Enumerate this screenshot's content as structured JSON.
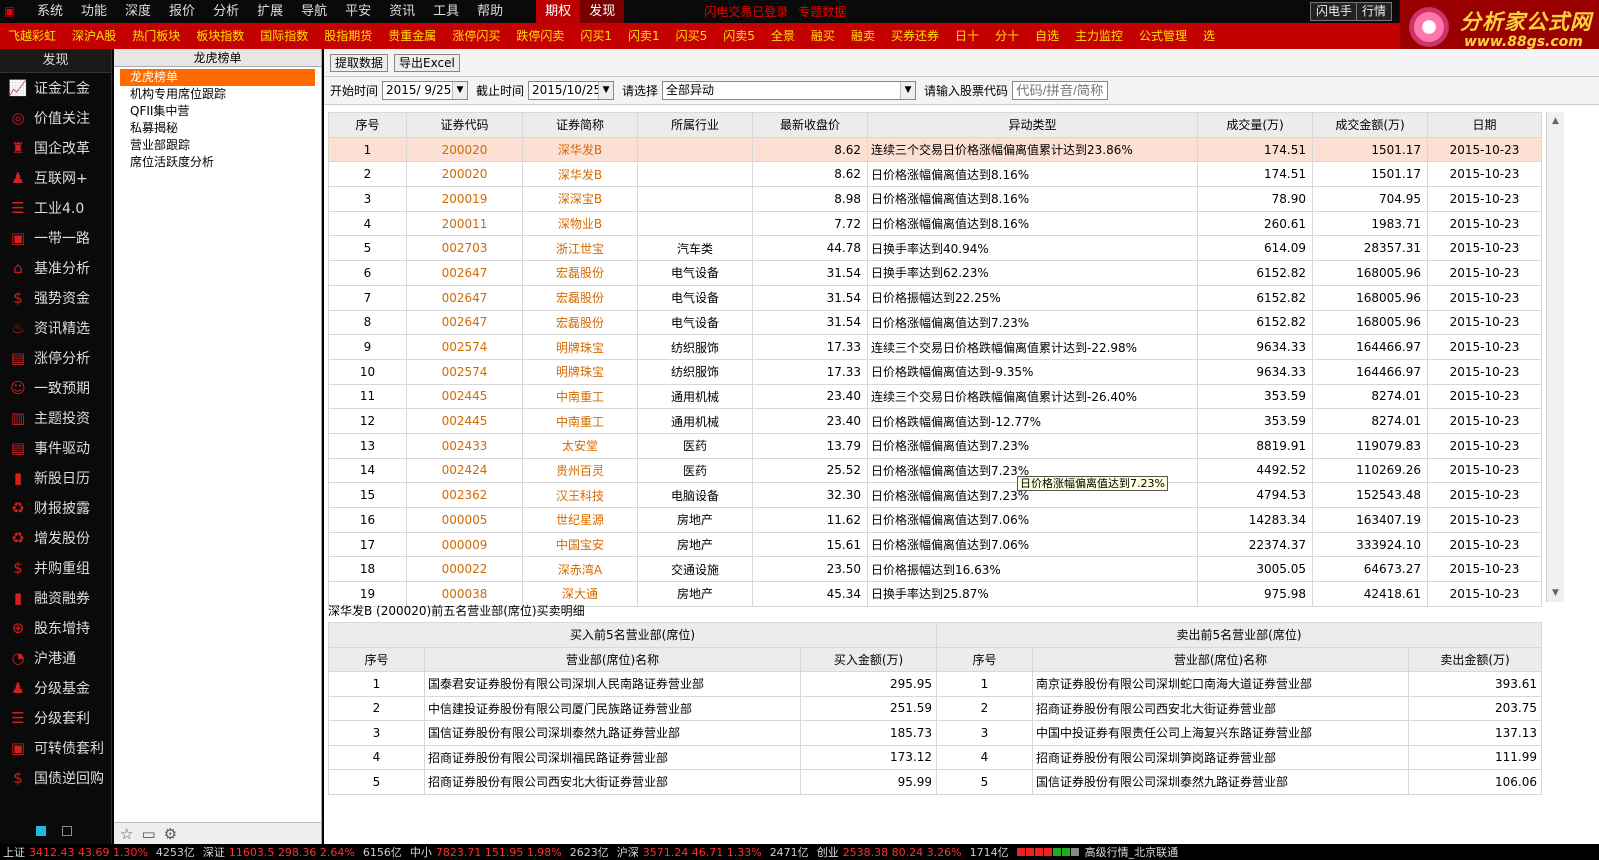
{
  "menubar": {
    "items": [
      "系统",
      "功能",
      "深度",
      "报价",
      "分析",
      "扩展",
      "导航",
      "平安",
      "资讯",
      "工具",
      "帮助"
    ],
    "tab_option": "期权",
    "tab_discover": "发现",
    "notice": "闪电交易已登录",
    "notice2": "专题数据",
    "right_btn1": "闪电手",
    "right_btn2": "行情"
  },
  "brand": {
    "title": "分析家公式网",
    "url": "www.88gs.com"
  },
  "toolbar": {
    "items": [
      "飞越彩虹",
      "深沪A股",
      "热门板块",
      "板块指数",
      "国际指数",
      "股指期货",
      "贵重金属",
      "涨停闪买",
      "跌停闪卖",
      "闪买1",
      "闪卖1",
      "闪买5",
      "闪卖5",
      "全景",
      "融买",
      "融卖",
      "买券还券",
      "日十",
      "分十",
      "自选",
      "主力监控",
      "公式管理",
      "选"
    ]
  },
  "sidebar": {
    "header": "发现",
    "items": [
      {
        "label": "证金汇金",
        "icon": "chart-line-icon"
      },
      {
        "label": "价值关注",
        "icon": "target-icon"
      },
      {
        "label": "国企改革",
        "icon": "building-icon"
      },
      {
        "label": "互联网+",
        "icon": "person-icon"
      },
      {
        "label": "工业4.0",
        "icon": "coins-icon"
      },
      {
        "label": "一带一路",
        "icon": "monitor-icon"
      },
      {
        "label": "基准分析",
        "icon": "bank-icon"
      },
      {
        "label": "强势资金",
        "icon": "money-icon"
      },
      {
        "label": "资讯精选",
        "icon": "piggy-icon"
      },
      {
        "label": "涨停分析",
        "icon": "window-icon"
      },
      {
        "label": "一致预期",
        "icon": "user-icon"
      },
      {
        "label": "主题投资",
        "icon": "briefcase-icon"
      },
      {
        "label": "事件驱动",
        "icon": "window-icon"
      },
      {
        "label": "新股日历",
        "icon": "bars-icon"
      },
      {
        "label": "财报披露",
        "icon": "cycle-icon"
      },
      {
        "label": "增发股份",
        "icon": "cycle-icon"
      },
      {
        "label": "并购重组",
        "icon": "money-icon"
      },
      {
        "label": "融资融券",
        "icon": "bars-icon"
      },
      {
        "label": "股东增持",
        "icon": "globe-icon"
      },
      {
        "label": "沪港通",
        "icon": "clock-icon"
      },
      {
        "label": "分级基金",
        "icon": "person-icon"
      },
      {
        "label": "分级套利",
        "icon": "coins-icon"
      },
      {
        "label": "可转债套利",
        "icon": "monitor-icon"
      },
      {
        "label": "国债逆回购",
        "icon": "money-icon"
      }
    ]
  },
  "tree": {
    "header": "龙虎榜单",
    "items": [
      "龙虎榜单",
      "机构专用席位跟踪",
      "QFII集中营",
      "私募揭秘",
      "营业部跟踪",
      "席位活跃度分析"
    ]
  },
  "actions": {
    "fetch": "提取数据",
    "export": "导出Excel"
  },
  "filter": {
    "start_label": "开始时间",
    "start_value": "2015/ 9/25",
    "end_label": "截止时间",
    "end_value": "2015/10/25",
    "select_label": "请选择",
    "select_value": "全部异动",
    "code_label": "请输入股票代码",
    "code_placeholder": "代码/拼音/简称"
  },
  "grid": {
    "headers": [
      "序号",
      "证券代码",
      "证券简称",
      "所属行业",
      "最新收盘价",
      "异动类型",
      "成交量(万)",
      "成交金额(万)",
      "日期"
    ],
    "rows": [
      [
        "1",
        "200020",
        "深华发B",
        "",
        "8.62",
        "连续三个交易日价格涨幅偏离值累计达到23.86%",
        "174.51",
        "1501.17",
        "2015-10-23"
      ],
      [
        "2",
        "200020",
        "深华发B",
        "",
        "8.62",
        "日价格涨幅偏离值达到8.16%",
        "174.51",
        "1501.17",
        "2015-10-23"
      ],
      [
        "3",
        "200019",
        "深深宝B",
        "",
        "8.98",
        "日价格涨幅偏离值达到8.16%",
        "78.90",
        "704.95",
        "2015-10-23"
      ],
      [
        "4",
        "200011",
        "深物业B",
        "",
        "7.72",
        "日价格涨幅偏离值达到8.16%",
        "260.61",
        "1983.71",
        "2015-10-23"
      ],
      [
        "5",
        "002703",
        "浙江世宝",
        "汽车类",
        "44.78",
        "日换手率达到40.94%",
        "614.09",
        "28357.31",
        "2015-10-23"
      ],
      [
        "6",
        "002647",
        "宏磊股份",
        "电气设备",
        "31.54",
        "日换手率达到62.23%",
        "6152.82",
        "168005.96",
        "2015-10-23"
      ],
      [
        "7",
        "002647",
        "宏磊股份",
        "电气设备",
        "31.54",
        "日价格振幅达到22.25%",
        "6152.82",
        "168005.96",
        "2015-10-23"
      ],
      [
        "8",
        "002647",
        "宏磊股份",
        "电气设备",
        "31.54",
        "日价格涨幅偏离值达到7.23%",
        "6152.82",
        "168005.96",
        "2015-10-23"
      ],
      [
        "9",
        "002574",
        "明牌珠宝",
        "纺织服饰",
        "17.33",
        "连续三个交易日价格跌幅偏离值累计达到-22.98%",
        "9634.33",
        "164466.97",
        "2015-10-23"
      ],
      [
        "10",
        "002574",
        "明牌珠宝",
        "纺织服饰",
        "17.33",
        "日价格跌幅偏离值达到-9.35%",
        "9634.33",
        "164466.97",
        "2015-10-23"
      ],
      [
        "11",
        "002445",
        "中南重工",
        "通用机械",
        "23.40",
        "连续三个交易日价格跌幅偏离值累计达到-26.40%",
        "353.59",
        "8274.01",
        "2015-10-23"
      ],
      [
        "12",
        "002445",
        "中南重工",
        "通用机械",
        "23.40",
        "日价格跌幅偏离值达到-12.77%",
        "353.59",
        "8274.01",
        "2015-10-23"
      ],
      [
        "13",
        "002433",
        "太安堂",
        "医药",
        "13.79",
        "日价格涨幅偏离值达到7.23%",
        "8819.91",
        "119079.83",
        "2015-10-23"
      ],
      [
        "14",
        "002424",
        "贵州百灵",
        "医药",
        "25.52",
        "日价格涨幅偏离值达到7.23%",
        "4492.52",
        "110269.26",
        "2015-10-23"
      ],
      [
        "15",
        "002362",
        "汉王科技",
        "电脑设备",
        "32.30",
        "日价格涨幅偏离值达到7.23%",
        "4794.53",
        "152543.48",
        "2015-10-23"
      ],
      [
        "16",
        "000005",
        "世纪星源",
        "房地产",
        "11.62",
        "日价格涨幅偏离值达到7.06%",
        "14283.34",
        "163407.19",
        "2015-10-23"
      ],
      [
        "17",
        "000009",
        "中国宝安",
        "房地产",
        "15.61",
        "日价格涨幅偏离值达到7.06%",
        "22374.37",
        "333924.10",
        "2015-10-23"
      ],
      [
        "18",
        "000022",
        "深赤湾A",
        "交通设施",
        "23.50",
        "日价格振幅达到16.63%",
        "3005.05",
        "64673.27",
        "2015-10-23"
      ],
      [
        "19",
        "000038",
        "深大通",
        "房地产",
        "45.34",
        "日换手率达到25.87%",
        "975.98",
        "42418.61",
        "2015-10-23"
      ]
    ]
  },
  "tooltip": "日价格涨幅偏离值达到7.23%",
  "detail": {
    "title": "深华发B (200020)前五名营业部(席位)买卖明细",
    "buy_group": "买入前5名营业部(席位)",
    "sell_group": "卖出前5名营业部(席位)",
    "headers_buy": [
      "序号",
      "营业部(席位)名称",
      "买入金额(万)"
    ],
    "headers_sell": [
      "序号",
      "营业部(席位)名称",
      "卖出金额(万)"
    ],
    "rows": [
      [
        "1",
        "国泰君安证券股份有限公司深圳人民南路证券营业部",
        "295.95",
        "1",
        "南京证券股份有限公司深圳蛇口南海大道证券营业部",
        "393.61"
      ],
      [
        "2",
        "中信建投证券股份有限公司厦门民族路证券营业部",
        "251.59",
        "2",
        "招商证券股份有限公司西安北大街证券营业部",
        "203.75"
      ],
      [
        "3",
        "国信证券股份有限公司深圳泰然九路证券营业部",
        "185.73",
        "3",
        "中国中投证券有限责任公司上海复兴东路证券营业部",
        "137.13"
      ],
      [
        "4",
        "招商证券股份有限公司深圳福民路证券营业部",
        "173.12",
        "4",
        "招商证券股份有限公司深圳笋岗路证券营业部",
        "111.99"
      ],
      [
        "5",
        "招商证券股份有限公司西安北大街证券营业部",
        "95.99",
        "5",
        "国信证券股份有限公司深圳泰然九路证券营业部",
        "106.06"
      ]
    ]
  },
  "status": {
    "sh_label": "上证",
    "sh_vals": "3412.43  43.69  1.30%",
    "sh_vol": "4253亿",
    "sz_label": "深证",
    "sz_vals": "11603.5  298.36  2.64%",
    "sz_vol": "6156亿",
    "zx_label": "中小",
    "zx_vals": "7823.71  151.95  1.98%",
    "zx_vol": "2623亿",
    "hs_label": "沪深",
    "hs_vals": "3571.24  46.71  1.33%",
    "hs_vol": "2471亿",
    "cy_label": "创业",
    "cy_vals": "2538.38  80.24  3.26%",
    "cy_vol": "1714亿",
    "server": "高级行情_北京联通"
  }
}
